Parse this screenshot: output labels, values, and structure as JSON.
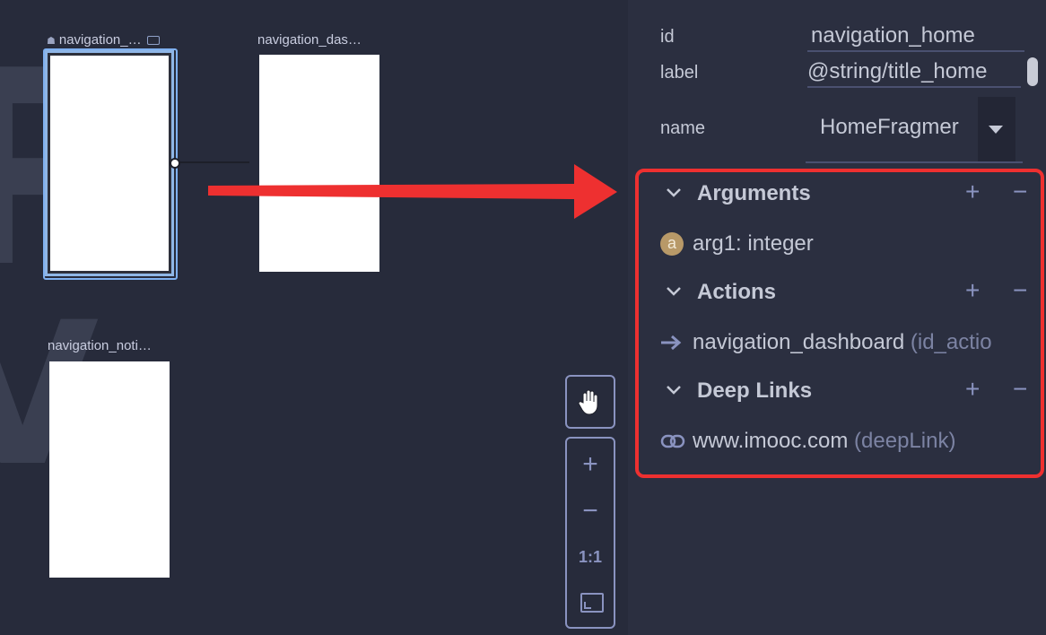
{
  "canvas": {
    "destinations": [
      {
        "label": "navigation_…",
        "is_start": true,
        "selected": true
      },
      {
        "label": "navigation_das…",
        "is_start": false,
        "selected": false
      },
      {
        "label": "navigation_noti…",
        "is_start": false,
        "selected": false
      }
    ],
    "tools": {
      "pan_icon": "hand-icon",
      "zoom_in": "+",
      "zoom_out": "−",
      "actual_size": "1:1",
      "fit_icon": "fit-screen-icon"
    }
  },
  "attributes": {
    "id_label": "id",
    "id_value": "navigation_home",
    "label_label": "label",
    "label_value": "@string/title_home",
    "name_label": "name",
    "name_value": "HomeFragmer"
  },
  "sections": {
    "arguments": {
      "title": "Arguments",
      "items": [
        {
          "badge": "a",
          "text": "arg1: integer"
        }
      ]
    },
    "actions": {
      "title": "Actions",
      "items": [
        {
          "text": "navigation_dashboard",
          "muted": "(id_actio"
        }
      ]
    },
    "deep_links": {
      "title": "Deep Links",
      "items": [
        {
          "text": "www.imooc.com",
          "muted": "(deepLink)"
        }
      ]
    },
    "add_symbol": "+",
    "remove_symbol": "−",
    "chevron": "⌄"
  },
  "colors": {
    "annotation_red": "#ee3030",
    "selection_blue": "#7fb0f0",
    "background": "#272b3b"
  }
}
